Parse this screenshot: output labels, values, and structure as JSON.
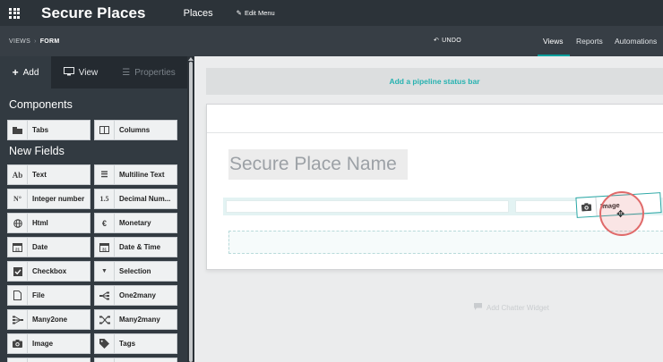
{
  "topbar": {
    "app_title": "Secure Places",
    "menu_places": "Places",
    "menu_edit": "Edit Menu"
  },
  "subbar": {
    "breadcrumb_root": "VIEWS",
    "breadcrumb_sep": "›",
    "breadcrumb_current": "FORM",
    "undo": "UNDO",
    "tabs": [
      "Views",
      "Reports",
      "Automations"
    ]
  },
  "sidebar": {
    "tabs": {
      "add": "Add",
      "view": "View",
      "properties": "Properties"
    },
    "components_title": "Components",
    "components": [
      {
        "label": "Tabs",
        "icon": "tabs-icon"
      },
      {
        "label": "Columns",
        "icon": "columns-icon"
      }
    ],
    "new_fields_title": "New Fields",
    "fields": [
      {
        "label": "Text",
        "icon": "text-icon",
        "glyph": "Ab"
      },
      {
        "label": "Multiline Text",
        "icon": "multiline-text-icon",
        "glyph": "☰"
      },
      {
        "label": "Integer number",
        "icon": "integer-icon",
        "glyph": "N°"
      },
      {
        "label": "Decimal Num...",
        "icon": "decimal-icon",
        "glyph": "1.5"
      },
      {
        "label": "Html",
        "icon": "globe-icon",
        "glyph": "◍"
      },
      {
        "label": "Monetary",
        "icon": "euro-icon",
        "glyph": "€"
      },
      {
        "label": "Date",
        "icon": "calendar-icon",
        "glyph": "21"
      },
      {
        "label": "Date & Time",
        "icon": "calendar-clock-icon",
        "glyph": "31"
      },
      {
        "label": "Checkbox",
        "icon": "checkbox-icon",
        "glyph": "☑"
      },
      {
        "label": "Selection",
        "icon": "caret-down-icon",
        "glyph": "▼"
      },
      {
        "label": "File",
        "icon": "file-icon",
        "glyph": "🗋"
      },
      {
        "label": "One2many",
        "icon": "one2many-icon",
        "glyph": "⇉"
      },
      {
        "label": "Many2one",
        "icon": "many2one-icon",
        "glyph": "⇶"
      },
      {
        "label": "Many2many",
        "icon": "many2many-icon",
        "glyph": "⤨"
      },
      {
        "label": "Image",
        "icon": "camera-icon",
        "glyph": "◘"
      },
      {
        "label": "Tags",
        "icon": "tag-icon",
        "glyph": "◆"
      }
    ]
  },
  "main": {
    "status_bar": "Add a pipeline status bar",
    "name_placeholder": "Secure Place Name",
    "chatter": "Add Chatter Widget",
    "drag_chip_label": "Image"
  },
  "colors": {
    "navbar": "#2c3339",
    "subbar": "#373e45",
    "sidebar": "#323a41",
    "accent": "#00a09d",
    "status_text": "#26b2b0"
  }
}
